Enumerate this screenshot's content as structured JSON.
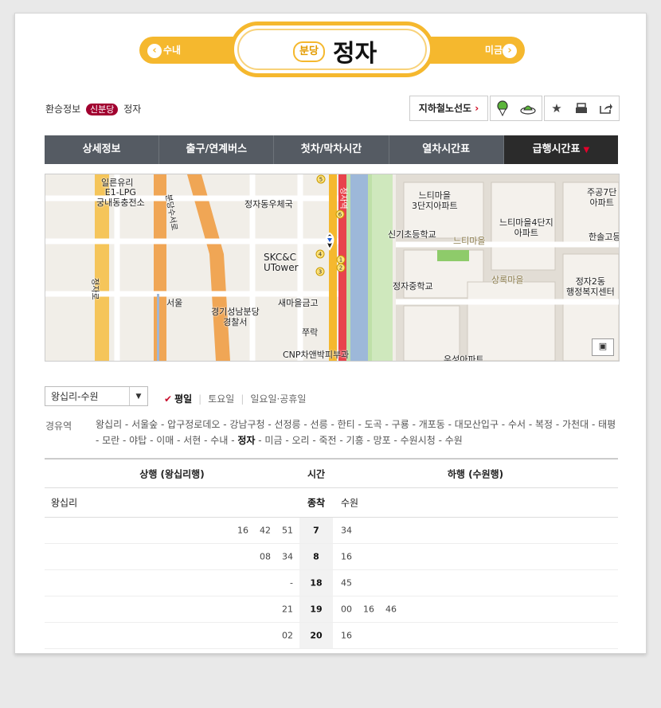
{
  "nav": {
    "prev_label": "수내",
    "next_label": "미금",
    "prev_chevron": "‹",
    "next_chevron": "›"
  },
  "station": {
    "line": "분당",
    "name": "정자"
  },
  "breadcrumb": {
    "root": "환승정보",
    "line_badge": "신분당",
    "station": "정자"
  },
  "tools": {
    "subway_map_label": "지하철노선도",
    "icons": [
      "pin-green-icon",
      "ufo-icon",
      "star-icon",
      "print-icon",
      "share-icon"
    ]
  },
  "tabs": [
    "상세정보",
    "출구/연계버스",
    "첫차/막차시간",
    "열차시간표",
    "급행시간표"
  ],
  "map": {
    "labels": {
      "lpg": "E1-LPG\n궁내동충전소",
      "road1": "정자로",
      "road2": "분당수서로",
      "post": "정자동우체국",
      "skc": "SKC&C\nUTower",
      "tg": "서울",
      "police": "경기성남분당\n경찰서",
      "saemaeul": "새마을금고",
      "jjuk": "쭈락",
      "cnp": "CNP차앤박피부과",
      "nuti3": "느티마을\n3단지아파트",
      "nuti4": "느티마을4단지\n아파트",
      "nutimaeul": "느티마을",
      "sinki": "신기초등학교",
      "jeongja_mid": "정자중학교",
      "sangrok": "상록마을",
      "jeongja2": "정자2동\n행정복지센터",
      "hansol": "한솔고등",
      "jugong": "주공7단\n아파트",
      "jeongjayeok": "정자역",
      "top_cut": "일른유리",
      "bottom_cut": "우성아파트"
    }
  },
  "filters": {
    "direction": "왕십리-수원",
    "days": [
      "평일",
      "토요일",
      "일요일·공휴일"
    ],
    "selected_day": "평일"
  },
  "via": {
    "label": "경유역",
    "stations_before": "왕십리 - 서울숲 - 압구정로데오 - 강남구청 - 선정릉 - 선릉 - 한티 - 도곡 - 구룡 - 개포동 - 대모산입구 - 수서 - 복정 - 가천대 - 태평 - 모란 - 야탑 - 이매 - 서현 - 수내 -",
    "current": "정자",
    "stations_after": "- 미금 - 오리 - 죽전 - 기흥 - 망포 - 수원시청 - 수원"
  },
  "timetable": {
    "up_header": "상행 (왕십리행)",
    "hour_header": "시간",
    "down_header": "하행 (수원행)",
    "up_dest": "왕십리",
    "hour_sub": "종착",
    "down_dest": "수원",
    "rows": [
      {
        "up": "16    42    51",
        "hour": "7",
        "down": "34"
      },
      {
        "up": "08    34",
        "hour": "8",
        "down": "16"
      },
      {
        "up": "-",
        "hour": "18",
        "down": "45"
      },
      {
        "up": "21",
        "hour": "19",
        "down": "00    16    46"
      },
      {
        "up": "02",
        "hour": "20",
        "down": "16"
      }
    ]
  },
  "colors": {
    "accent": "#f5b82e",
    "line_badge": "#a1002f",
    "tab_bg": "#555b63",
    "tab_active": "#2b2b2b"
  }
}
